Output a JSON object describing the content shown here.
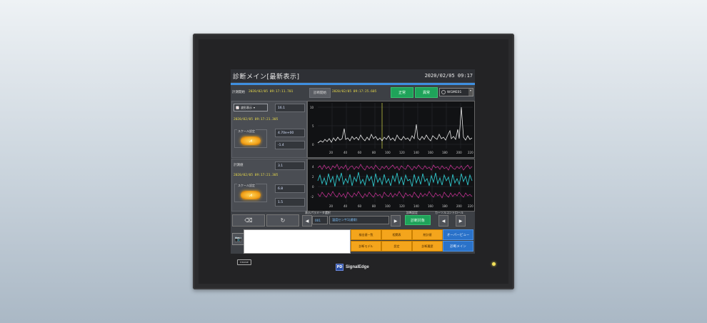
{
  "device": {
    "model_label": "H300SE",
    "brand": "SignalEdge",
    "brand_badge": "PD"
  },
  "screen": {
    "title": "診断メイン[最新表示]",
    "clock": "2020/02/05 09:17",
    "measure_start_label": "計測開始",
    "measure_start_value": "2020/02/05 09:17:11.701",
    "diag_start_label": "診断開始",
    "diag_start_value": "2020/02/05 09:17:25.605",
    "btn_normal": "正常",
    "btn_abnormal": "異常",
    "select_value": "WGME01",
    "panel1": {
      "display_button": "波形表示",
      "value_top": "16.1",
      "timestamp": "2020/02/05 09:17:21.305",
      "scale_label": "スケール設定",
      "scale_max": "4.70e+00",
      "scale_min": "-1.4",
      "icon": "chart-scale-icon"
    },
    "panel2": {
      "label": "計測値",
      "value_top": "3.1",
      "timestamp": "2020/02/05 09:17:21.305",
      "scale_label": "スケール設定",
      "scale_max": "6.8",
      "scale_min": "1.5",
      "icon": "chart-scale-icon"
    },
    "chart1": {
      "y_ticks": [
        "10",
        "5",
        "0"
      ],
      "x_ticks": [
        "20",
        "40",
        "60",
        "80",
        "100",
        "120",
        "140",
        "160",
        "180",
        "200",
        "220"
      ]
    },
    "chart2": {
      "y_ticks": [
        "4",
        "2",
        "0",
        "-2"
      ],
      "x_ticks": [
        "20",
        "40",
        "60",
        "80",
        "100",
        "120",
        "140",
        "160",
        "180",
        "200",
        "220"
      ]
    },
    "toolbar": {
      "eraser_icon": "eraser-icon",
      "refresh_icon": "refresh-icon",
      "param_group_label": "表示パラメータ選択",
      "param_id": "001",
      "param_name": "温度センサ1(通常)",
      "diag_group_label": "診断設定",
      "diag_button": "診断対象",
      "cursor_group_label": "カーソルコントロール",
      "left_arrow": "◀",
      "right_arrow": "▶"
    },
    "bottom": {
      "camera_icon": "camera-icon",
      "orange_buttons": [
        "検出値一覧",
        "相関表",
        "統計値",
        "診断モデル",
        "設定",
        "診断履歴"
      ],
      "blue_buttons": [
        "オーバービュー",
        "診断メイン"
      ]
    }
  }
}
